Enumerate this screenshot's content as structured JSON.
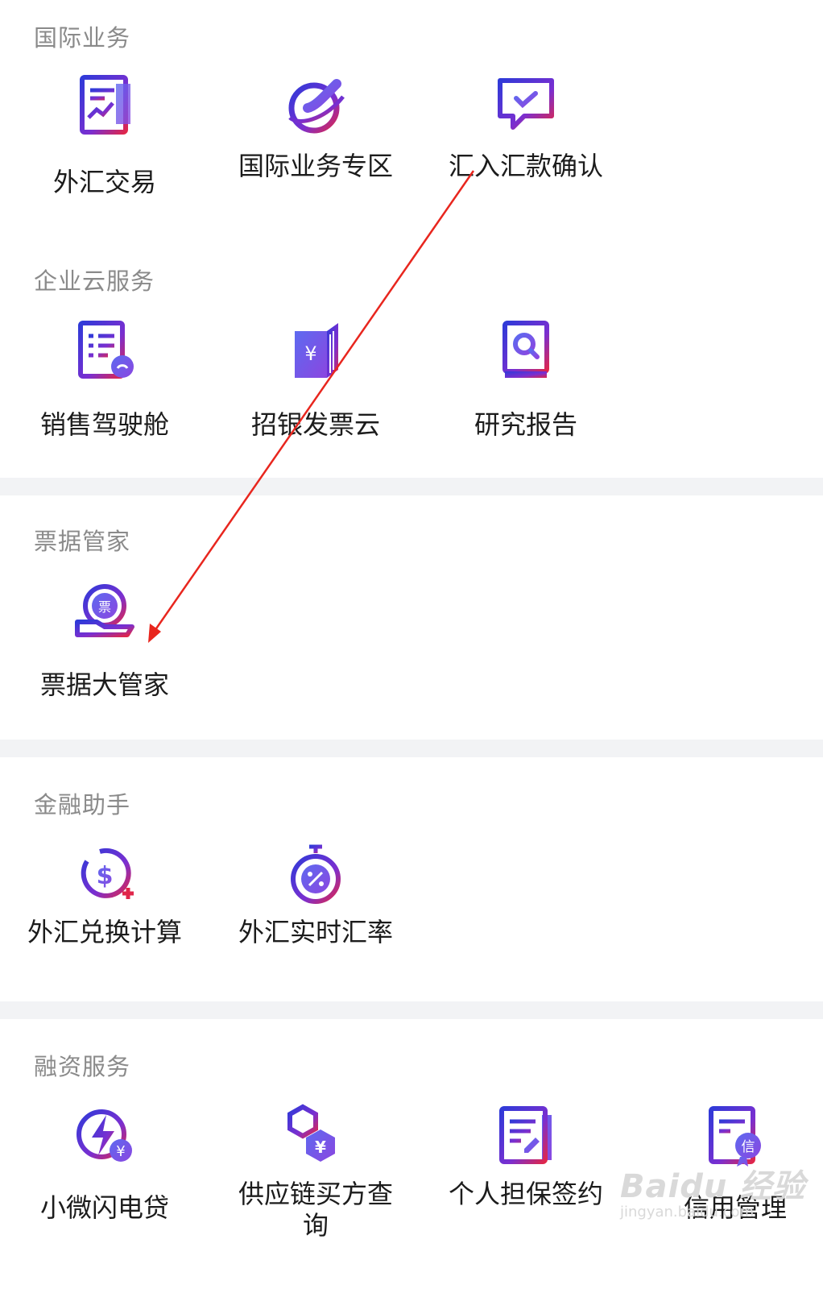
{
  "sections": [
    {
      "title": "国际业务",
      "items": [
        {
          "label": "外汇交易",
          "icon": "chart-document-icon"
        },
        {
          "label": "国际业务专区",
          "icon": "globe-plane-icon"
        },
        {
          "label": "汇入汇款确认",
          "icon": "chat-check-icon"
        }
      ]
    },
    {
      "title": "企业云服务",
      "items": [
        {
          "label": "销售驾驶舱",
          "icon": "dashboard-report-icon"
        },
        {
          "label": "招银发票云",
          "icon": "invoice-book-icon"
        },
        {
          "label": "研究报告",
          "icon": "search-book-icon"
        }
      ]
    },
    {
      "title": "票据管家",
      "items": [
        {
          "label": "票据大管家",
          "icon": "bill-hand-icon"
        }
      ]
    },
    {
      "title": "金融助手",
      "items": [
        {
          "label": "外汇兑换计算",
          "icon": "currency-timer-icon"
        },
        {
          "label": "外汇实时汇率",
          "icon": "percent-stopwatch-icon"
        }
      ]
    },
    {
      "title": "融资服务",
      "items": [
        {
          "label": "小微闪电贷",
          "icon": "lightning-yuan-icon"
        },
        {
          "label": "供应链买方查询",
          "icon": "hexagon-yuan-icon"
        },
        {
          "label": "个人担保签约",
          "icon": "sign-document-icon"
        },
        {
          "label": "信用管理",
          "icon": "credit-document-icon"
        }
      ]
    }
  ],
  "watermark": {
    "logo": "Baidu 经验",
    "url": "jingyan.baidu.com"
  },
  "colors": {
    "icon_blue": "#3a36d6",
    "icon_purple": "#8a2bcf",
    "icon_red": "#d8224c",
    "annotation": "#e8261e",
    "divider": "#f2f3f5"
  }
}
